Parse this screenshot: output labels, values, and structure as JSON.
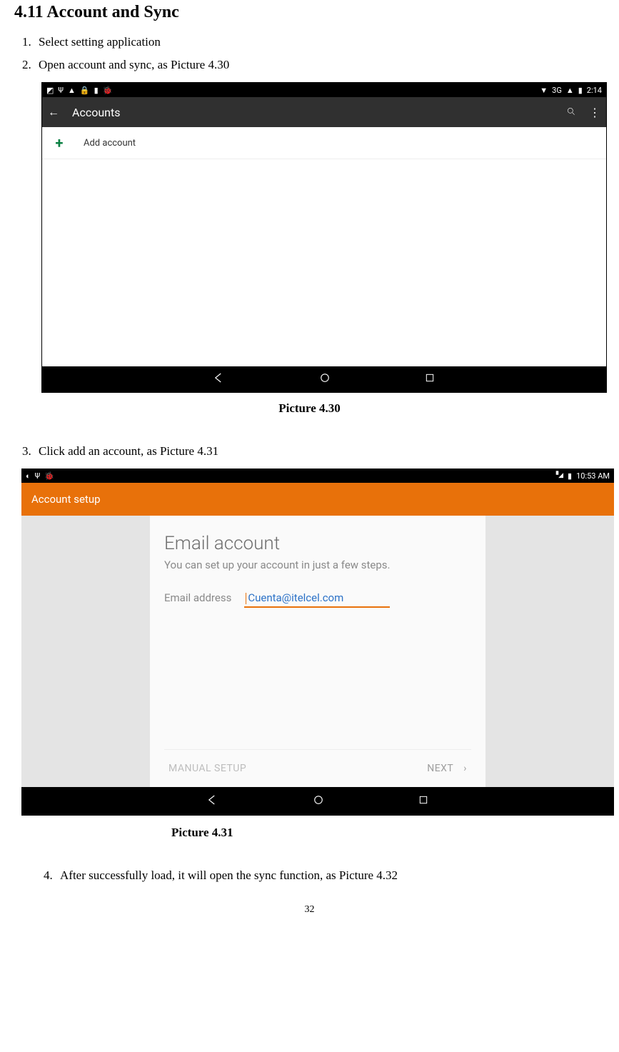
{
  "section_title": "4.11 Account and Sync",
  "steps_a": [
    "Select setting application",
    "Open account and sync, as Picture 4.30"
  ],
  "caption_1": "Picture 4.30",
  "steps_b": [
    "Click add an account, as Picture 4.31"
  ],
  "caption_2": "Picture 4.31",
  "steps_c": [
    "After successfully load, it will open the sync function, as Picture 4.32"
  ],
  "page_number": "32",
  "ss1": {
    "status_left_icons": [
      "screenshot-icon",
      "usb-icon",
      "warning-icon",
      "lock-icon",
      "app-icon",
      "debug-icon"
    ],
    "status_right": {
      "network": "3G",
      "signal": "▲",
      "battery": "▮",
      "time": "2:14"
    },
    "toolbar": {
      "title": "Accounts"
    },
    "list": {
      "add_label": "Add account"
    }
  },
  "ss2": {
    "status_left_icons": [
      "chrome-icon",
      "usb-icon",
      "debug-icon"
    ],
    "status_right": {
      "signal": "▞",
      "battery": "▮",
      "time": "10:53 AM"
    },
    "toolbar_title": "Account setup",
    "card": {
      "heading": "Email account",
      "sub": "You can set up your account in just a few steps.",
      "field_label": "Email address",
      "field_value": "Cuenta@itelcel.com",
      "manual": "MANUAL SETUP",
      "next": "NEXT"
    }
  }
}
